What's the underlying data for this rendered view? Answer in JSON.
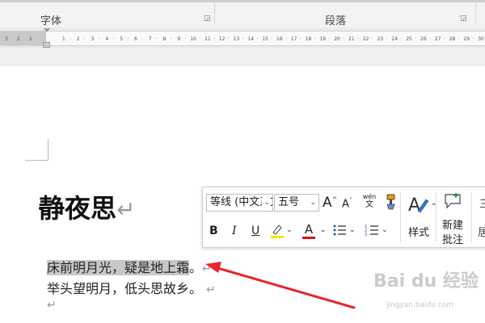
{
  "ribbon": {
    "group_font": "字体",
    "group_paragraph": "段落"
  },
  "ruler": {
    "left_ticks": [
      "3",
      "2",
      "1"
    ],
    "ticks": [
      "1",
      "2",
      "3",
      "4",
      "5",
      "6",
      "7",
      "8",
      "9",
      "10",
      "11",
      "12",
      "13",
      "14",
      "15",
      "16",
      "17",
      "18",
      "19",
      "20",
      "21",
      "22",
      "23",
      "24",
      "25",
      "26",
      "27",
      "28",
      "29",
      "30",
      "31"
    ]
  },
  "document": {
    "title": "静夜思",
    "paragraph_mark": "↵",
    "line1_selected": "床前明月光，疑是地上霜",
    "line1_tail": "。",
    "line2": "举头望明月，低头思故乡。",
    "empty_mark": "↵"
  },
  "mini_toolbar": {
    "font_name": "等线 (中文正文)",
    "font_size": "五号",
    "grow_font": "A",
    "shrink_font": "A",
    "phonetic_top": "wén",
    "phonetic_bottom": "文",
    "bold": "B",
    "italic": "I",
    "underline": "U",
    "font_color_letter": "A",
    "styles_label": "样式",
    "new_comment_line1": "新建",
    "new_comment_line2": "批注",
    "partial_top": "三",
    "partial_bottom": "居",
    "highlight_color": "#f5e400",
    "font_color": "#e01010"
  },
  "watermark": {
    "brand": "Bai du 经验",
    "url": "jingyan.baidu.com"
  }
}
